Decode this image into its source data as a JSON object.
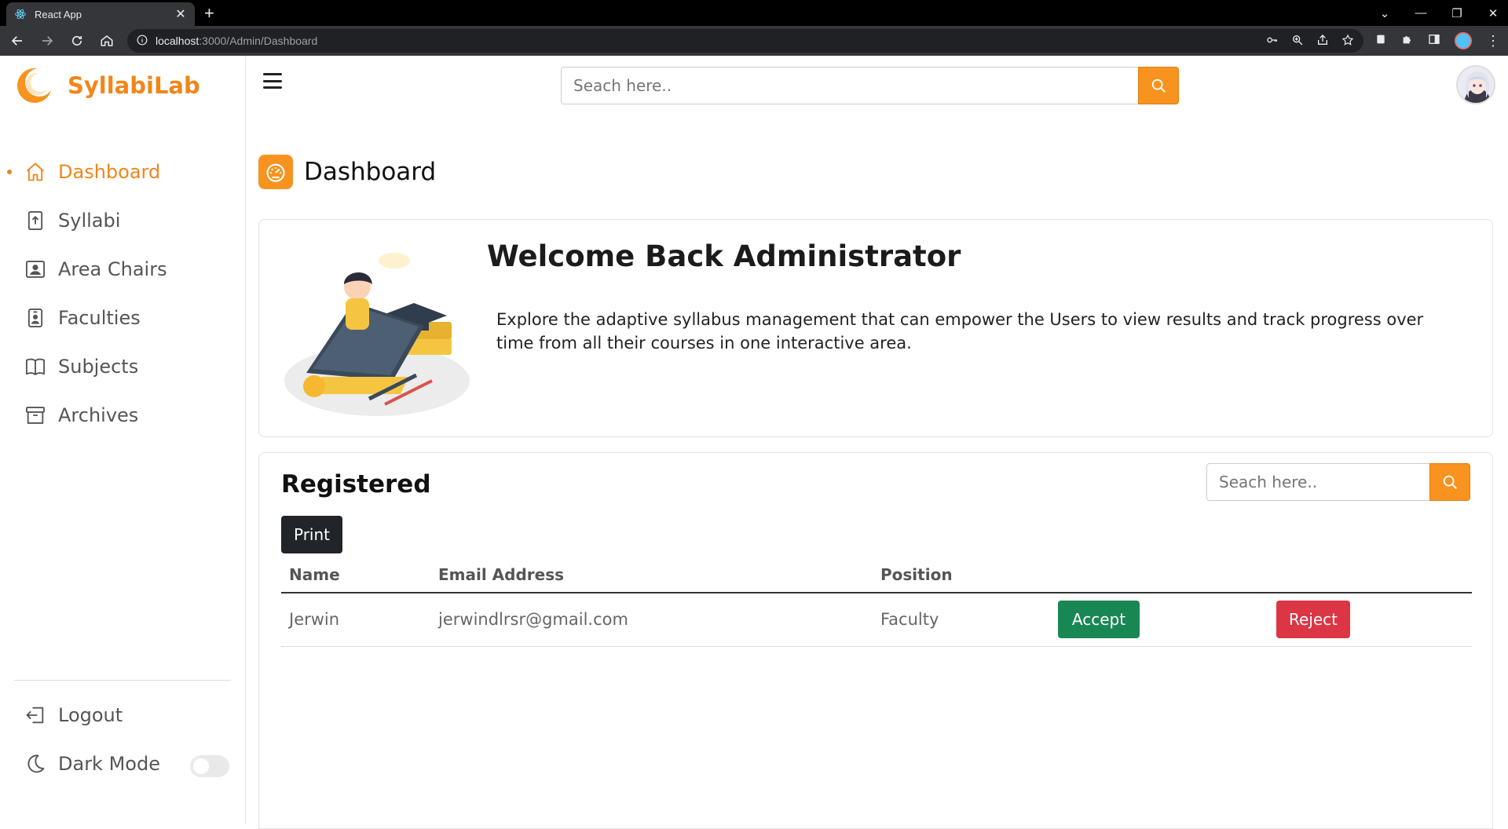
{
  "browser": {
    "tab_title": "React App",
    "url_host": "localhost",
    "url_path": ":3000/Admin/Dashboard"
  },
  "brand": {
    "name": "SyllabiLab"
  },
  "sidebar": {
    "items": [
      {
        "label": "Dashboard",
        "icon": "home-icon",
        "active": true
      },
      {
        "label": "Syllabi",
        "icon": "file-upload-icon"
      },
      {
        "label": "Area Chairs",
        "icon": "person-card-icon"
      },
      {
        "label": "Faculties",
        "icon": "person-badge-icon"
      },
      {
        "label": "Subjects",
        "icon": "book-icon"
      },
      {
        "label": "Archives",
        "icon": "archive-icon"
      }
    ],
    "logout_label": "Logout",
    "dark_mode_label": "Dark Mode",
    "dark_mode_on": false
  },
  "header": {
    "search_placeholder": "Seach here.."
  },
  "page": {
    "title": "Dashboard"
  },
  "welcome": {
    "title": "Welcome Back Administrator",
    "text": "Explore the adaptive syllabus management that can empower the Users to view results and track progress over time from all their courses in one interactive area."
  },
  "registered": {
    "title": "Registered",
    "search_placeholder": "Seach here..",
    "print_label": "Print",
    "columns": [
      "Name",
      "Email Address",
      "Position"
    ],
    "rows": [
      {
        "name": "Jerwin",
        "email": "jerwindlrsr@gmail.com",
        "position": "Faculty",
        "accept_label": "Accept",
        "reject_label": "Reject"
      }
    ]
  },
  "colors": {
    "accent": "#f7931e",
    "brand": "#f0861a",
    "accept": "#198754",
    "reject": "#dc3545",
    "dark": "#212529"
  }
}
